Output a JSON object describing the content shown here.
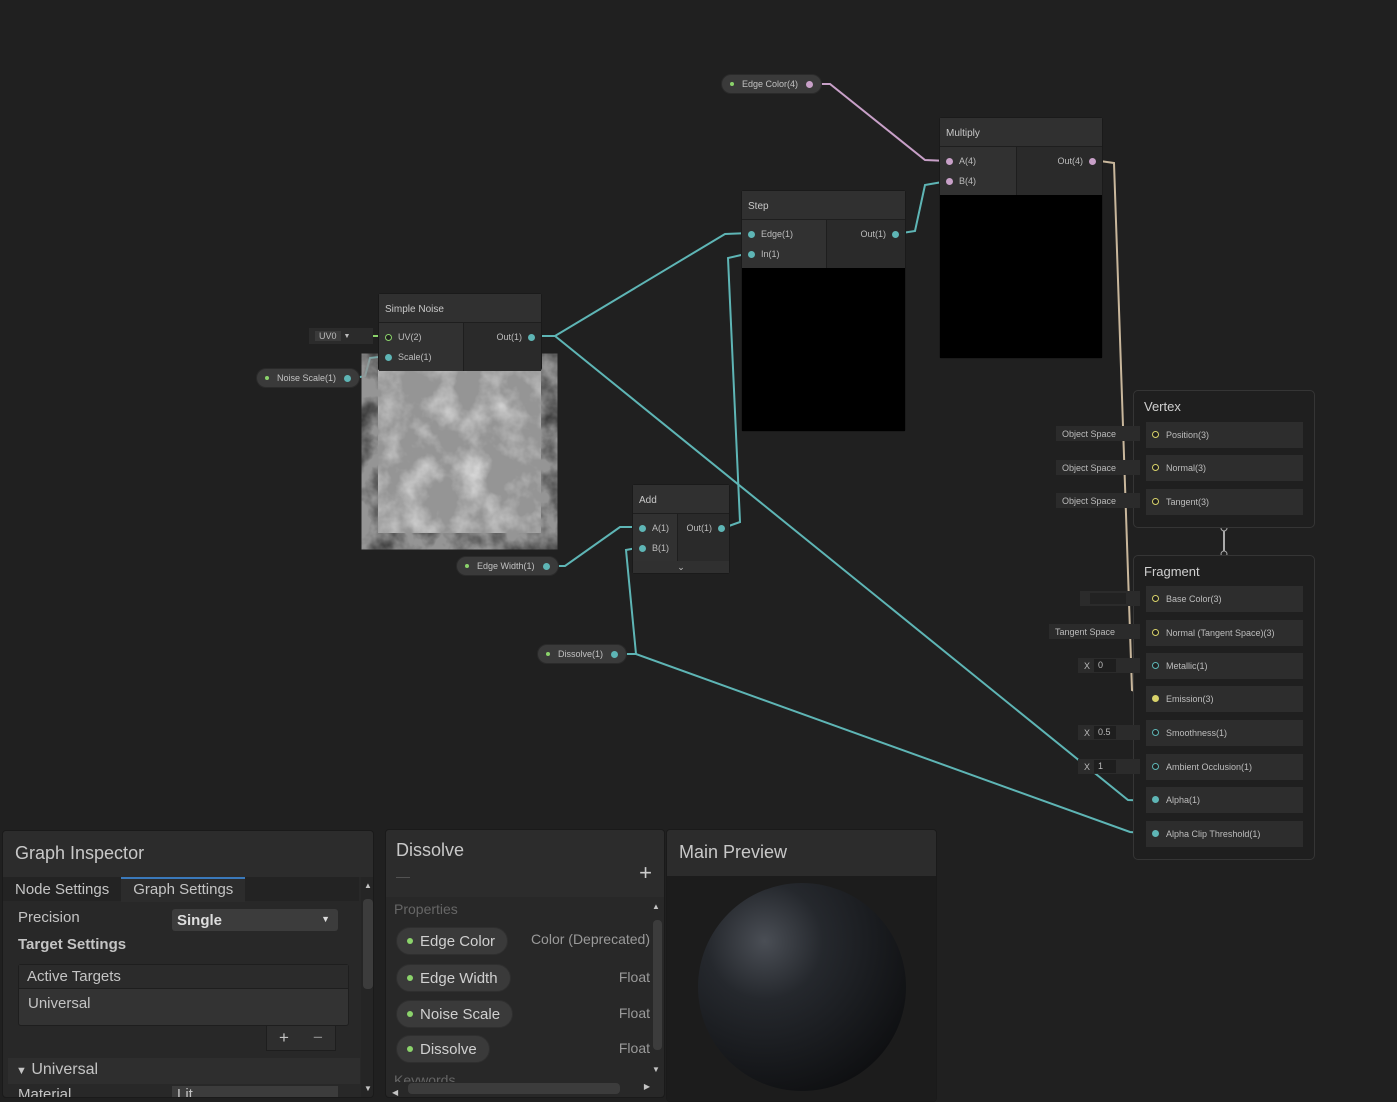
{
  "graph": {
    "nodes": {
      "simple_noise": {
        "title": "Simple Noise",
        "inputs": [
          "UV(2)",
          "Scale(1)"
        ],
        "output": "Out(1)",
        "uv_dropdown": "UV0"
      },
      "step": {
        "title": "Step",
        "inputs": [
          "Edge(1)",
          "In(1)"
        ],
        "output": "Out(1)"
      },
      "multiply": {
        "title": "Multiply",
        "inputs": [
          "A(4)",
          "B(4)"
        ],
        "output": "Out(4)"
      },
      "add": {
        "title": "Add",
        "inputs": [
          "A(1)",
          "B(1)"
        ],
        "output": "Out(1)"
      }
    },
    "property_nodes": {
      "edge_color": "Edge Color(4)",
      "noise_scale": "Noise Scale(1)",
      "edge_width": "Edge Width(1)",
      "dissolve": "Dissolve(1)"
    },
    "vertex": {
      "title": "Vertex",
      "slots": [
        {
          "label": "Position(3)",
          "inline": "Object Space"
        },
        {
          "label": "Normal(3)",
          "inline": "Object Space"
        },
        {
          "label": "Tangent(3)",
          "inline": "Object Space"
        }
      ]
    },
    "fragment": {
      "title": "Fragment",
      "slots": [
        {
          "label": "Base Color(3)",
          "inline": ""
        },
        {
          "label": "Normal (Tangent Space)(3)",
          "inline": "Tangent Space"
        },
        {
          "label": "Metallic(1)",
          "inline_axis": "X",
          "inline_value": "0"
        },
        {
          "label": "Emission(3)"
        },
        {
          "label": "Smoothness(1)",
          "inline_axis": "X",
          "inline_value": "0.5"
        },
        {
          "label": "Ambient Occlusion(1)",
          "inline_axis": "X",
          "inline_value": "1"
        },
        {
          "label": "Alpha(1)"
        },
        {
          "label": "Alpha Clip Threshold(1)"
        }
      ]
    },
    "colors": {
      "float_wire": "#5eb5b5",
      "vector_wire": "#d8d26a",
      "vector4_wire": "#c8a0c8",
      "property_dot": "#8bd36b"
    }
  },
  "inspector": {
    "title": "Graph Inspector",
    "tabs": [
      "Node Settings",
      "Graph Settings"
    ],
    "active_tab": "Graph Settings",
    "precision_label": "Precision",
    "precision_value": "Single",
    "target_settings": "Target Settings",
    "active_targets": "Active Targets",
    "targets": [
      "Universal"
    ],
    "add": "+",
    "remove": "−",
    "section": "Universal",
    "material_label": "Material",
    "material_value": "Lit"
  },
  "blackboard": {
    "title": "Dissolve",
    "subtitle": "—",
    "add": "+",
    "properties_label": "Properties",
    "properties": [
      {
        "name": "Edge Color",
        "type": "Color (Deprecated)"
      },
      {
        "name": "Edge Width",
        "type": "Float"
      },
      {
        "name": "Noise Scale",
        "type": "Float"
      },
      {
        "name": "Dissolve",
        "type": "Float"
      }
    ],
    "keywords_label": "Keywords"
  },
  "preview": {
    "title": "Main Preview"
  }
}
